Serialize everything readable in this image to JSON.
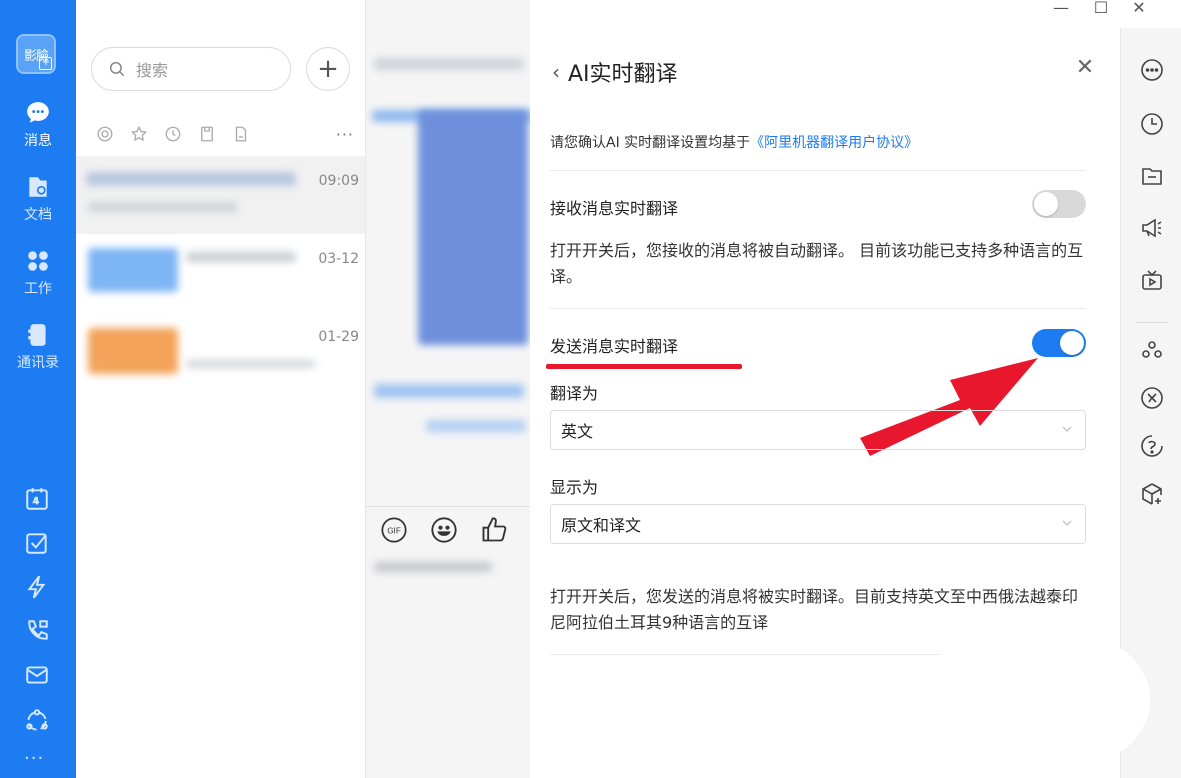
{
  "colors": {
    "accent": "#1d7cf2",
    "annotation_red": "#e8172d"
  },
  "window": {
    "minimize": "—",
    "maximize": "☐",
    "close": "✕"
  },
  "nav": {
    "avatar_text": "影臉",
    "avatar_badge": "+",
    "items": [
      {
        "label": "消息",
        "icon": "message-icon"
      },
      {
        "label": "文档",
        "icon": "document-icon"
      },
      {
        "label": "工作",
        "icon": "apps-icon"
      },
      {
        "label": "通讯录",
        "icon": "contacts-icon"
      }
    ],
    "tools": [
      "calendar-icon",
      "todo-icon",
      "flash-icon",
      "phone-icon",
      "mail-icon",
      "community-icon"
    ],
    "more": "···"
  },
  "list": {
    "search_placeholder": "搜索",
    "add_label": "+",
    "filter_more": "···",
    "conversations": [
      {
        "time": "09:09"
      },
      {
        "time": "03-12"
      },
      {
        "time": "01-29"
      }
    ]
  },
  "panel": {
    "back": "‹",
    "title": "AI实时翻译",
    "close": "✕",
    "notice_prefix": "请您确认AI 实时翻译设置均基于",
    "notice_link": "《阿里机器翻译用户协议》",
    "receive_label": "接收消息实时翻译",
    "receive_on": false,
    "receive_desc": "打开开关后，您接收的消息将被自动翻译。 目前该功能已支持多种语言的互译。",
    "send_label": "发送消息实时翻译",
    "send_on": true,
    "translate_to_label": "翻译为",
    "translate_to_value": "英文",
    "display_as_label": "显示为",
    "display_as_value": "原文和译文",
    "send_desc": "打开开关后，您发送的消息将被实时翻译。目前支持英文至中西俄法越泰印尼阿拉伯土耳其9种语言的互译"
  }
}
